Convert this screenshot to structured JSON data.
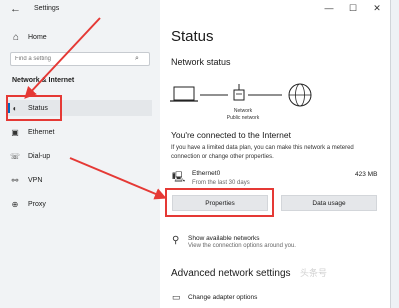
{
  "window": {
    "title": "Settings",
    "back_glyph": "←",
    "caption": {
      "minimize": "—",
      "maximize": "☐",
      "close": "✕"
    }
  },
  "sidebar": {
    "home": {
      "icon": "home-icon",
      "label": "Home"
    },
    "search": {
      "placeholder": "Find a setting",
      "icon": "search-icon"
    },
    "group_label": "Network & Internet",
    "items": [
      {
        "icon": "globe-icon",
        "label": "Status",
        "active": true
      },
      {
        "icon": "ethernet-icon",
        "label": "Ethernet"
      },
      {
        "icon": "dialup-icon",
        "label": "Dial-up"
      },
      {
        "icon": "vpn-icon",
        "label": "VPN"
      },
      {
        "icon": "proxy-icon",
        "label": "Proxy"
      }
    ]
  },
  "main": {
    "title": "Status",
    "network_status_heading": "Network status",
    "diagram": {
      "network_label": "Network",
      "network_sublabel": "Public network"
    },
    "connected_heading": "You're connected to the Internet",
    "description": "If you have a limited data plan, you can make this network a metered connection or change other properties.",
    "connection": {
      "name": "Ethernet0",
      "sub": "From the last 30 days",
      "usage": "423 MB"
    },
    "buttons": {
      "properties": "Properties",
      "data_usage": "Data usage"
    },
    "available": {
      "title": "Show available networks",
      "sub": "View the connection options around you."
    },
    "advanced_heading": "Advanced network settings",
    "adapter_options": "Change adapter options"
  },
  "annotation_color": "#e53935",
  "watermark": "头条号"
}
